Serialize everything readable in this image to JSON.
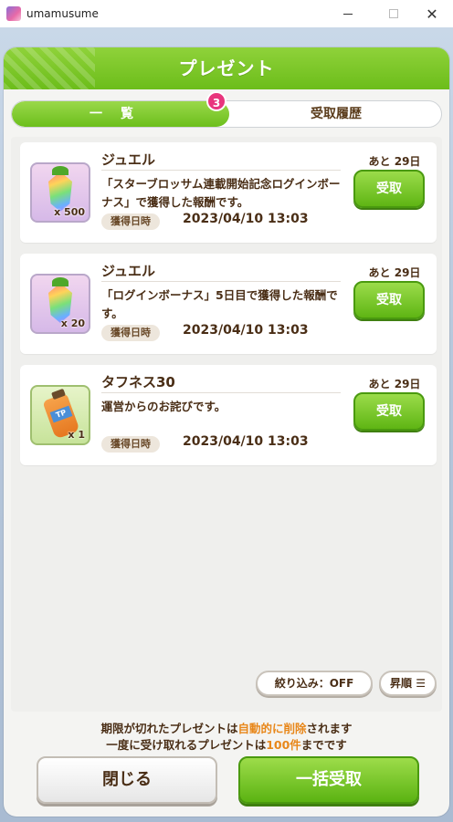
{
  "window": {
    "title": "umamusume",
    "minimize_icon": "minimize-icon",
    "maximize_icon": "maximize-icon",
    "close_glyph": "✕"
  },
  "dialog": {
    "title": "プレゼント",
    "tabs": [
      {
        "label": "一覧",
        "active": true
      },
      {
        "label": "受取履歴",
        "active": false
      }
    ],
    "badge_count": "3"
  },
  "presents": [
    {
      "name": "ジュエル",
      "icon": "jewel-icon",
      "quantity": "x 500",
      "description": "「スターブロッサム連載開始記念ログインボーナス」で獲得した報酬です。",
      "date_label": "獲得日時",
      "date": "2023/04/10 13:03",
      "remaining": "あと 29日",
      "button": "受取"
    },
    {
      "name": "ジュエル",
      "icon": "jewel-icon",
      "quantity": "x 20",
      "description": "「ログインボーナス」5日目で獲得した報酬です。",
      "date_label": "獲得日時",
      "date": "2023/04/10 13:03",
      "remaining": "あと 29日",
      "button": "受取"
    },
    {
      "name": "タフネス30",
      "icon": "toughness-bottle-icon",
      "quantity": "x 1",
      "tp_label": "TP",
      "description": "運営からのお詫びです。",
      "date_label": "獲得日時",
      "date": "2023/04/10 13:03",
      "remaining": "あと 29日",
      "button": "受取"
    }
  ],
  "filters": {
    "narrow": "絞り込み：OFF",
    "order": "昇順",
    "order_icon": "sort-icon"
  },
  "notices": {
    "line1_a": "期限が切れたプレゼントは",
    "line1_b": "自動的に削除",
    "line1_c": "されます",
    "line2_a": "一度に受け取れるプレゼントは",
    "line2_b": "100件",
    "line2_c": "までです"
  },
  "buttons": {
    "close": "閉じる",
    "receive_all": "一括受取"
  },
  "colors": {
    "accent_green": "#6cbd1a",
    "badge_pink": "#e8357d",
    "highlight_orange": "#e8871a",
    "text_brown": "#4a2e16"
  }
}
